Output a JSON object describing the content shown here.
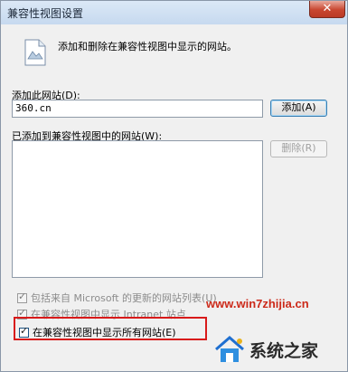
{
  "window": {
    "title": "兼容性视图设置"
  },
  "header": {
    "description": "添加和删除在兼容性视图中显示的网站。"
  },
  "add_section": {
    "label": "添加此网站(D):",
    "input_value": "360.cn",
    "add_button": "添加(A)"
  },
  "list_section": {
    "label": "已添加到兼容性视图中的网站(W):",
    "items": [],
    "remove_button": "删除(R)"
  },
  "options": [
    {
      "label": "包括来自 Microsoft 的更新的网站列表(U)",
      "checked": true
    },
    {
      "label": "在兼容性视图中显示 Intranet 站点",
      "checked": true
    },
    {
      "label": "在兼容性视图中显示所有网站(E)",
      "checked": true
    }
  ],
  "watermark": {
    "url": "www.win7zhijia.cn",
    "logo_text": "系统之家",
    "icon": "house-logo-icon"
  },
  "colors": {
    "highlight": "#d81a1a",
    "watermark": "#cc2a1a"
  }
}
